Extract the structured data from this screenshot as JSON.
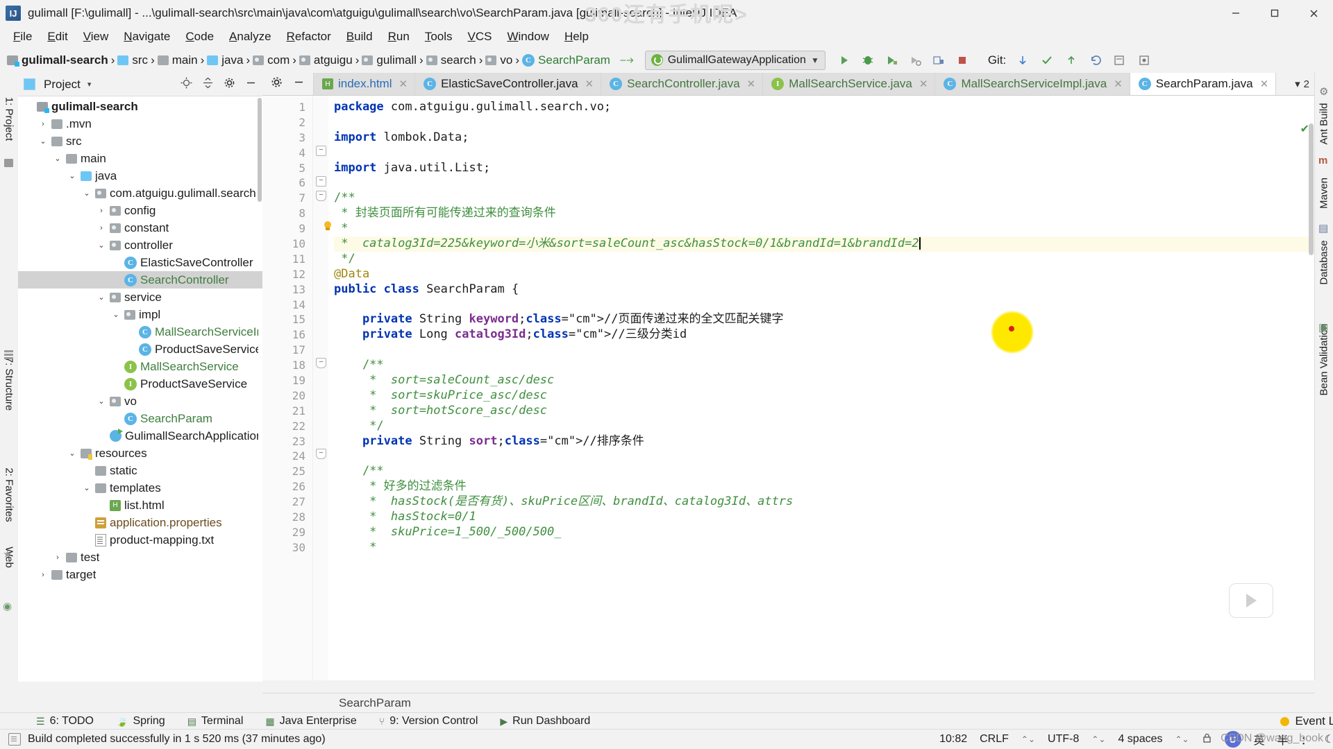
{
  "window": {
    "title": "gulimall [F:\\gulimall] - ...\\gulimall-search\\src\\main\\java\\com\\atguigu\\gulimall\\search\\vo\\SearchParam.java [gulimall-search] - IntelliJ IDEA",
    "app_icon": "intellij-idea-icon",
    "minimize": "minimize-icon",
    "maximize": "maximize-icon",
    "close": "close-icon"
  },
  "watermark": {
    "top": "360还有手机呢>",
    "bottom": "CSDN @wang_book"
  },
  "menu": [
    "File",
    "Edit",
    "View",
    "Navigate",
    "Code",
    "Analyze",
    "Refactor",
    "Build",
    "Run",
    "Tools",
    "VCS",
    "Window",
    "Help"
  ],
  "navbar": {
    "breadcrumbs": [
      {
        "label": "gulimall-search",
        "icon": "module-icon",
        "style": "bold"
      },
      {
        "label": "src",
        "icon": "source-folder-icon",
        "style": "plain"
      },
      {
        "label": "main",
        "icon": "folder-icon",
        "style": "plain"
      },
      {
        "label": "java",
        "icon": "source-folder-icon",
        "style": "plain"
      },
      {
        "label": "com",
        "icon": "package-icon",
        "style": "plain"
      },
      {
        "label": "atguigu",
        "icon": "package-icon",
        "style": "plain"
      },
      {
        "label": "gulimall",
        "icon": "package-icon",
        "style": "plain"
      },
      {
        "label": "search",
        "icon": "package-icon",
        "style": "plain"
      },
      {
        "label": "vo",
        "icon": "package-icon",
        "style": "plain"
      },
      {
        "label": "SearchParam",
        "icon": "class-icon",
        "style": "green"
      }
    ],
    "run_config": {
      "label": "GulimallGatewayApplication",
      "icon": "spring-boot-icon",
      "chevron": "▼"
    },
    "toolbar_icons": [
      "run-icon",
      "debug-icon",
      "run-with-coverage-icon",
      "profile-icon",
      "attach-debugger-icon",
      "stop-icon"
    ],
    "git": {
      "label": "Git:",
      "icons": [
        "update-project-icon",
        "commit-icon",
        "push-icon",
        "rollback-icon",
        "show-history-icon",
        "branch-icon"
      ]
    }
  },
  "project_panel": {
    "title": "Project",
    "title_chevron": "▾",
    "actions": [
      "locate-icon",
      "collapse-all-icon",
      "settings-icon",
      "hide-icon"
    ],
    "tree": [
      {
        "indent": 0,
        "arrow": "",
        "icon": "module-icon",
        "label": "gulimall-search",
        "style": "bold"
      },
      {
        "indent": 1,
        "arrow": "›",
        "icon": "folder-icon",
        "label": ".mvn",
        "style": "plain"
      },
      {
        "indent": 1,
        "arrow": "⌄",
        "icon": "folder-icon",
        "label": "src",
        "style": "plain"
      },
      {
        "indent": 2,
        "arrow": "⌄",
        "icon": "folder-icon",
        "label": "main",
        "style": "plain"
      },
      {
        "indent": 3,
        "arrow": "⌄",
        "icon": "source-folder-icon",
        "label": "java",
        "style": "plain"
      },
      {
        "indent": 4,
        "arrow": "⌄",
        "icon": "package-icon",
        "label": "com.atguigu.gulimall.search",
        "style": "plain"
      },
      {
        "indent": 5,
        "arrow": "›",
        "icon": "package-icon",
        "label": "config",
        "style": "plain"
      },
      {
        "indent": 5,
        "arrow": "›",
        "icon": "package-icon",
        "label": "constant",
        "style": "plain"
      },
      {
        "indent": 5,
        "arrow": "⌄",
        "icon": "package-icon",
        "label": "controller",
        "style": "plain"
      },
      {
        "indent": 6,
        "arrow": "",
        "icon": "class-icon",
        "label": "ElasticSaveController",
        "style": "plain"
      },
      {
        "indent": 6,
        "arrow": "",
        "icon": "class-icon",
        "label": "SearchController",
        "style": "green",
        "selected": true
      },
      {
        "indent": 5,
        "arrow": "⌄",
        "icon": "package-icon",
        "label": "service",
        "style": "plain"
      },
      {
        "indent": 6,
        "arrow": "⌄",
        "icon": "package-icon",
        "label": "impl",
        "style": "plain"
      },
      {
        "indent": 7,
        "arrow": "",
        "icon": "class-icon",
        "label": "MallSearchServiceImpl",
        "style": "green"
      },
      {
        "indent": 7,
        "arrow": "",
        "icon": "class-icon",
        "label": "ProductSaveServiceImpl",
        "style": "plain"
      },
      {
        "indent": 6,
        "arrow": "",
        "icon": "interface-icon",
        "label": "MallSearchService",
        "style": "green"
      },
      {
        "indent": 6,
        "arrow": "",
        "icon": "interface-icon",
        "label": "ProductSaveService",
        "style": "plain"
      },
      {
        "indent": 5,
        "arrow": "⌄",
        "icon": "package-icon",
        "label": "vo",
        "style": "plain"
      },
      {
        "indent": 6,
        "arrow": "",
        "icon": "class-icon",
        "label": "SearchParam",
        "style": "green"
      },
      {
        "indent": 5,
        "arrow": "",
        "icon": "spring-class-icon",
        "label": "GulimallSearchApplication",
        "style": "plain"
      },
      {
        "indent": 3,
        "arrow": "⌄",
        "icon": "resource-folder-icon",
        "label": "resources",
        "style": "plain"
      },
      {
        "indent": 4,
        "arrow": "",
        "icon": "folder-icon",
        "label": "static",
        "style": "plain"
      },
      {
        "indent": 4,
        "arrow": "⌄",
        "icon": "folder-icon",
        "label": "templates",
        "style": "plain"
      },
      {
        "indent": 5,
        "arrow": "",
        "icon": "html-file-icon",
        "label": "list.html",
        "style": "plain"
      },
      {
        "indent": 4,
        "arrow": "",
        "icon": "properties-file-icon",
        "label": "application.properties",
        "style": "brown"
      },
      {
        "indent": 4,
        "arrow": "",
        "icon": "text-file-icon",
        "label": "product-mapping.txt",
        "style": "plain"
      },
      {
        "indent": 2,
        "arrow": "›",
        "icon": "folder-icon",
        "label": "test",
        "style": "plain"
      },
      {
        "indent": 1,
        "arrow": "›",
        "icon": "folder-icon",
        "label": "target",
        "style": "plain"
      }
    ]
  },
  "left_strips": [
    {
      "label": "1: Project"
    },
    {
      "label": "7: Structure"
    },
    {
      "label": "2: Favorites"
    },
    {
      "label": "Web"
    }
  ],
  "right_strips": [
    {
      "label": "Ant Build"
    },
    {
      "label": "Maven"
    },
    {
      "label": "Database"
    },
    {
      "label": "Bean Validation"
    }
  ],
  "editor": {
    "tools": [
      "settings-icon",
      "hide-icon"
    ],
    "tabs": [
      {
        "label": "index.html",
        "icon": "html-file-icon",
        "active": false,
        "color": "blue"
      },
      {
        "label": "ElasticSaveController.java",
        "icon": "class-icon",
        "active": false,
        "color": "dark"
      },
      {
        "label": "SearchController.java",
        "icon": "class-icon",
        "active": false,
        "color": "green"
      },
      {
        "label": "MallSearchService.java",
        "icon": "interface-icon",
        "active": false,
        "color": "green"
      },
      {
        "label": "MallSearchServiceImpl.java",
        "icon": "class-icon",
        "active": false,
        "color": "green"
      },
      {
        "label": "SearchParam.java",
        "icon": "class-icon",
        "active": true,
        "color": "dark"
      }
    ],
    "tabs_overflow": "2",
    "breadcrumb_bottom": "SearchParam",
    "line_numbers": [
      1,
      2,
      3,
      4,
      5,
      6,
      7,
      8,
      9,
      10,
      11,
      12,
      13,
      14,
      15,
      16,
      17,
      18,
      19,
      20,
      21,
      22,
      23,
      24,
      25,
      26,
      27,
      28,
      29,
      30
    ],
    "code_lines": [
      "package com.atguigu.gulimall.search.vo;",
      "",
      "import lombok.Data;",
      "",
      "import java.util.List;",
      "",
      "/**",
      " * 封装页面所有可能传递过来的查询条件",
      " *",
      " *  catalog3Id=225&keyword=小米&sort=saleCount_asc&hasStock=0/1&brandId=1&brandId=2",
      " */",
      "@Data",
      "public class SearchParam {",
      "",
      "    private String keyword;//页面传递过来的全文匹配关键字",
      "    private Long catalog3Id;//三级分类id",
      "",
      "    /**",
      "     *  sort=saleCount_asc/desc",
      "     *  sort=skuPrice_asc/desc",
      "     *  sort=hotScore_asc/desc",
      "     */",
      "    private String sort;//排序条件",
      "",
      "    /**",
      "     * 好多的过滤条件",
      "     *  hasStock(是否有货)、skuPrice区间、brandId、catalog3Id、attrs",
      "     *  hasStock=0/1",
      "     *  skuPrice=1_500/_500/500_",
      "     *"
    ],
    "highlighted_line": 10,
    "caret_line_number": 10
  },
  "bottom_tools": [
    {
      "label": "6: TODO",
      "icon": "todo-icon"
    },
    {
      "label": "Spring",
      "icon": "spring-icon"
    },
    {
      "label": "Terminal",
      "icon": "terminal-icon"
    },
    {
      "label": "Java Enterprise",
      "icon": "java-enterprise-icon"
    },
    {
      "label": "9: Version Control",
      "icon": "version-control-icon"
    },
    {
      "label": "Run Dashboard",
      "icon": "run-dashboard-icon"
    }
  ],
  "event_log": {
    "label": "Event Log",
    "icon": "event-log-icon"
  },
  "status_bar": {
    "message": "Build completed successfully in 1 s 520 ms (37 minutes ago)",
    "icon": "build-icon",
    "caret_position": "10:82",
    "line_separator": "CRLF",
    "encoding": "UTF-8",
    "indent": "4 spaces",
    "ime_badge": "U",
    "ime_text": "英",
    "ime_extras": [
      "半",
      "：",
      "☾"
    ],
    "lock_icon": "lock-icon"
  },
  "colors": {
    "accent_green": "#3f8f3f",
    "keyword_blue": "#0033b3",
    "field_purple": "#7a2d8f",
    "annotation_gold": "#9e880d",
    "highlight_yellow": "#ffe800",
    "cursor_red": "#d81f1f",
    "selection_gray": "#d2d2d2"
  }
}
